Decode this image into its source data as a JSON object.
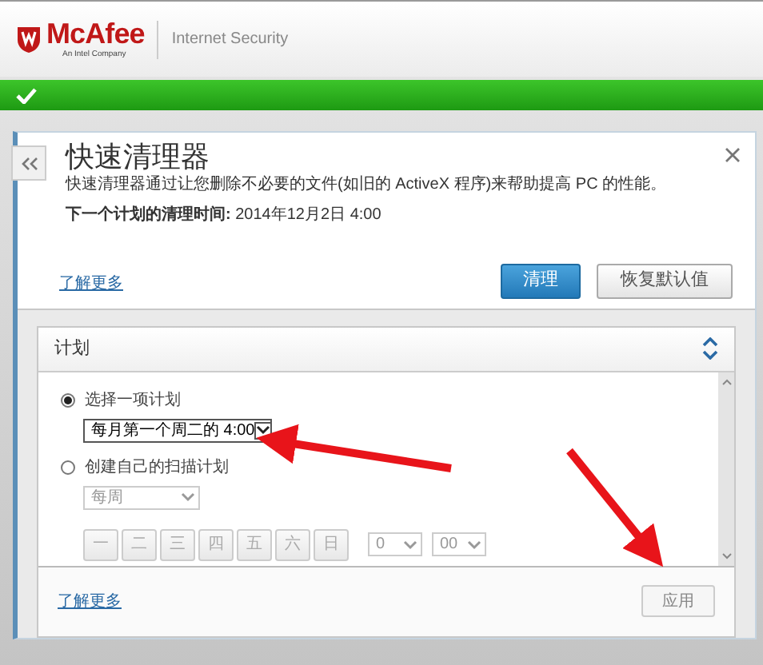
{
  "header": {
    "brand": "McAfee",
    "tagline": "An Intel Company",
    "product": "Internet Security"
  },
  "status": {
    "ok": true
  },
  "panel": {
    "title": "快速清理器",
    "description": "快速清理器通过让您删除不必要的文件(如旧的 ActiveX 程序)来帮助提高 PC 的性能。",
    "next_run": "**下一个计划的清理时间:** 2014年12月2日 4:00",
    "learn_more": "了解更多",
    "buttons": [
      {
        "label": "清理",
        "kind": "primary"
      },
      {
        "label": "恢复默认值",
        "kind": "secondary"
      }
    ]
  },
  "schedule": {
    "title": "计划",
    "expanded": true,
    "options": [
      {
        "label": "选择一项计划",
        "selected": true,
        "dropdown": "每月第一个周二的 4:00"
      },
      {
        "label": "创建自己的扫描计划",
        "selected": false,
        "dropdown": "每周"
      }
    ],
    "days": [
      "一",
      "二",
      "三",
      "四",
      "五",
      "六",
      "日"
    ],
    "hour": "0",
    "minute": "00",
    "learn_more": "了解更多",
    "apply": {
      "label": "应用",
      "disabled": true
    }
  }
}
